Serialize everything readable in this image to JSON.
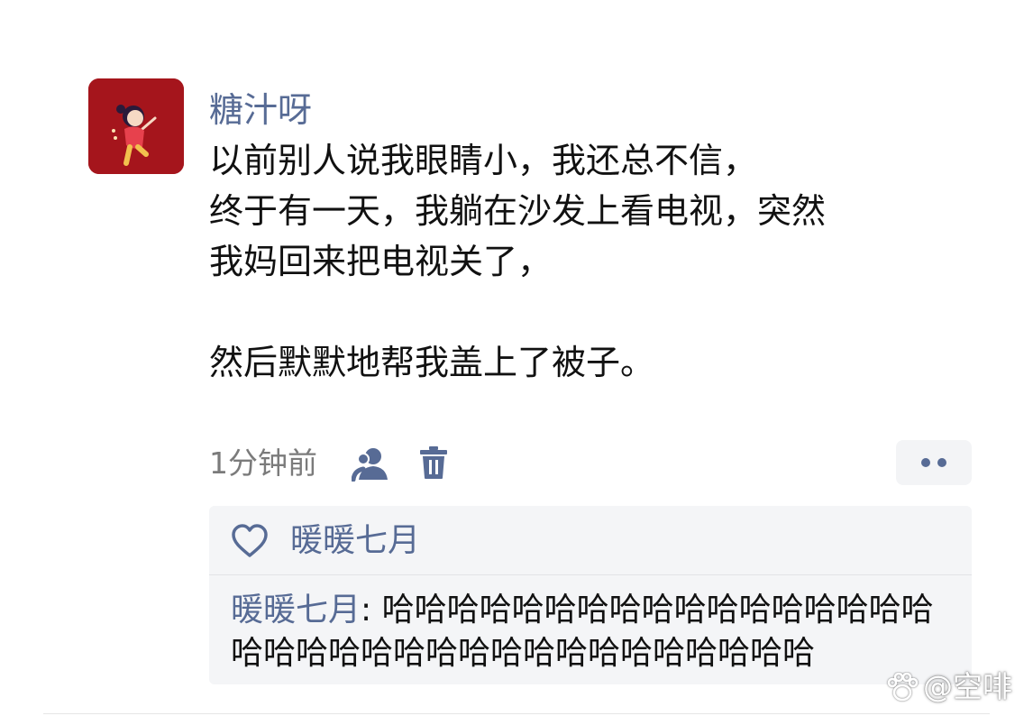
{
  "post": {
    "username": "糖汁呀",
    "text": "以前别人说我眼睛小，我还总不信，\n终于有一天，我躺在沙发上看电视，突然\n我妈回来把电视关了，\n\n然后默默地帮我盖上了被子。",
    "time": "1分钟前"
  },
  "icons": {
    "privacy": "people-icon",
    "delete": "trash-icon",
    "more": "more-dots-icon",
    "like": "heart-outline-icon"
  },
  "interactions": {
    "likes": [
      "暖暖七月"
    ],
    "comments": [
      {
        "author": "暖暖七月",
        "separator": ": ",
        "text": "哈哈哈哈哈哈哈哈哈哈哈哈哈哈哈哈哈哈哈哈哈哈哈哈哈哈哈哈哈哈哈哈哈哈哈"
      }
    ]
  },
  "watermark": {
    "text": "@空啡"
  },
  "colors": {
    "link": "#576b95",
    "text": "#111111",
    "meta": "#7b7b7b",
    "panel": "#f4f5f7",
    "avatar_bg": "#a5151c"
  }
}
